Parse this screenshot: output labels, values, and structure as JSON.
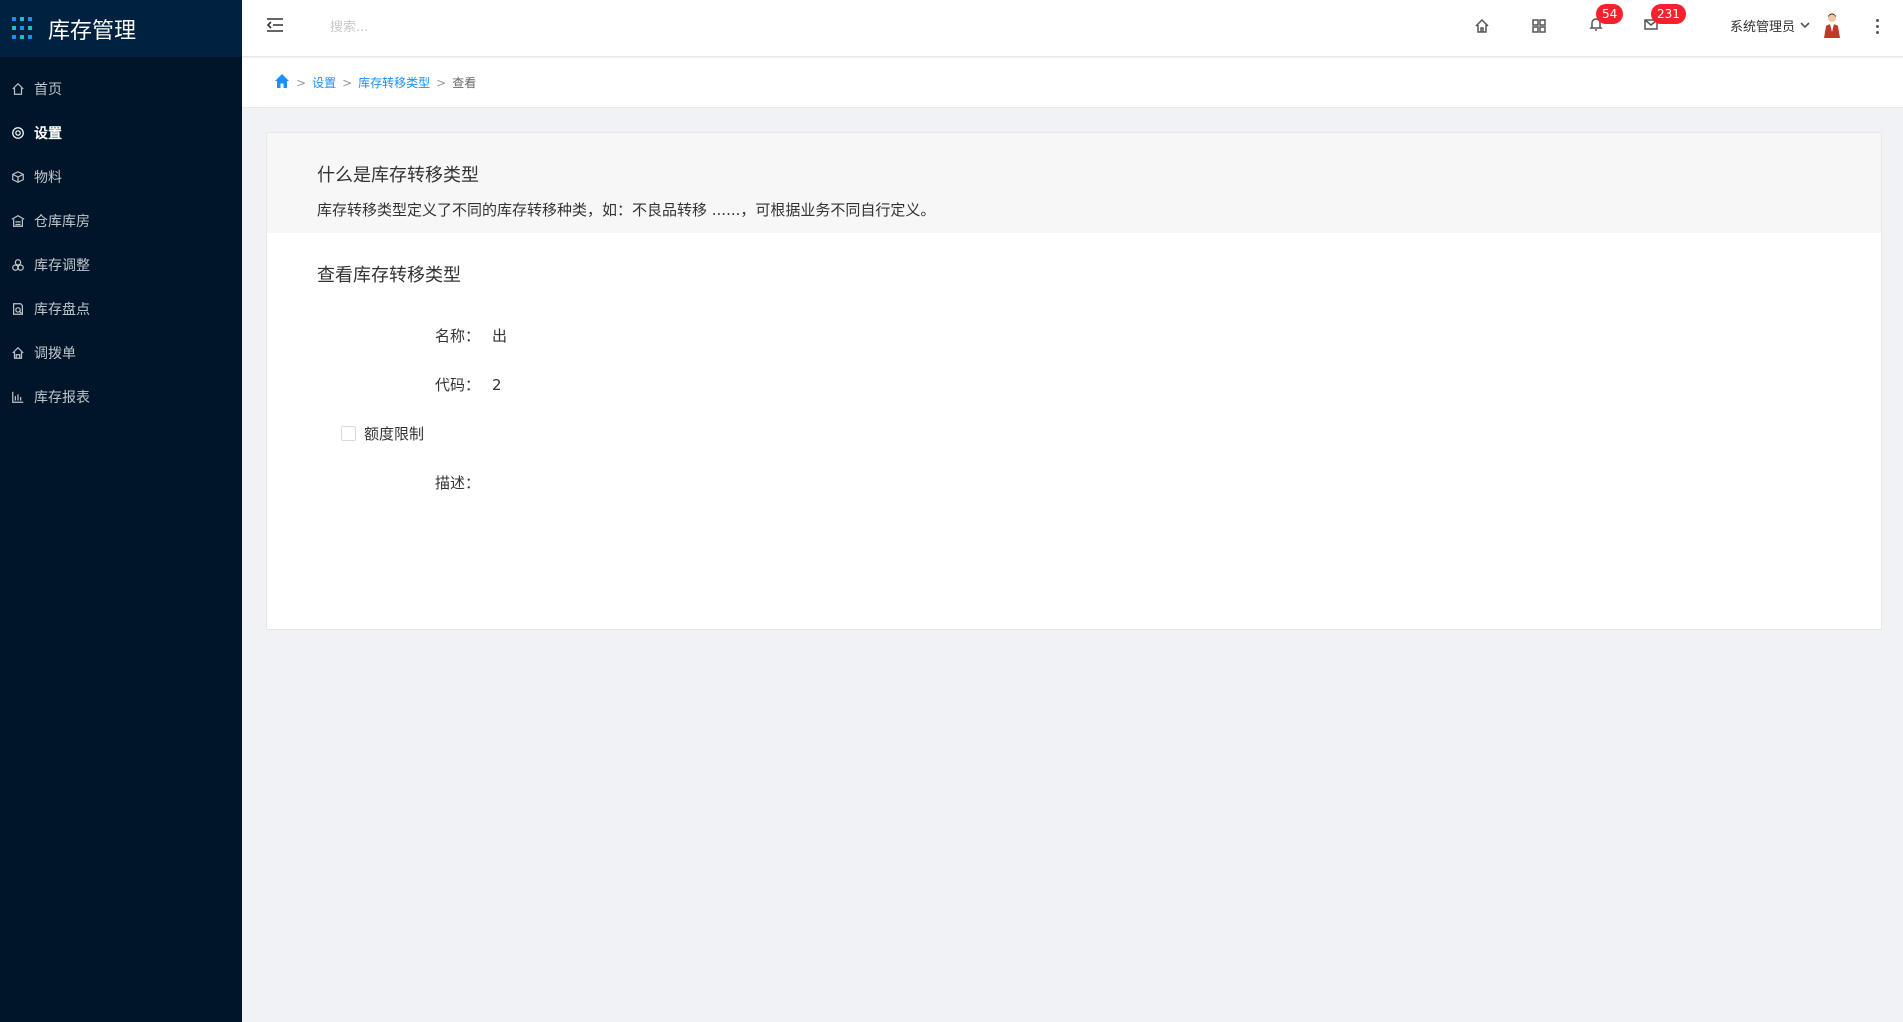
{
  "app": {
    "title": "库存管理"
  },
  "colors": {
    "sidebar_bg": "#001529",
    "accent": "#1890ff",
    "badge": "#f5222d"
  },
  "sidebar": {
    "items": [
      {
        "label": "首页",
        "icon": "home-icon"
      },
      {
        "label": "设置",
        "icon": "gear-icon",
        "active": true
      },
      {
        "label": "物料",
        "icon": "box-icon"
      },
      {
        "label": "仓库库房",
        "icon": "warehouse-icon"
      },
      {
        "label": "库存调整",
        "icon": "adjust-icon"
      },
      {
        "label": "库存盘点",
        "icon": "inventory-check-icon"
      },
      {
        "label": "调拨单",
        "icon": "transfer-icon"
      },
      {
        "label": "库存报表",
        "icon": "bar-chart-icon"
      }
    ]
  },
  "header": {
    "search_placeholder": "搜索...",
    "notifications_count": "54",
    "messages_count": "231",
    "user_name": "系统管理员"
  },
  "breadcrumb": {
    "items": [
      "设置",
      "库存转移类型"
    ],
    "current": "查看"
  },
  "info": {
    "title": "什么是库存转移类型",
    "description": "库存转移类型定义了不同的库存转移种类，如：不良品转移 ......，可根据业务不同自行定义。"
  },
  "view": {
    "title": "查看库存转移类型",
    "name_label": "名称：",
    "name_value": "出",
    "code_label": "代码：",
    "code_value": "2",
    "limit_label": "额度限制",
    "desc_label": "描述：",
    "desc_value": ""
  }
}
